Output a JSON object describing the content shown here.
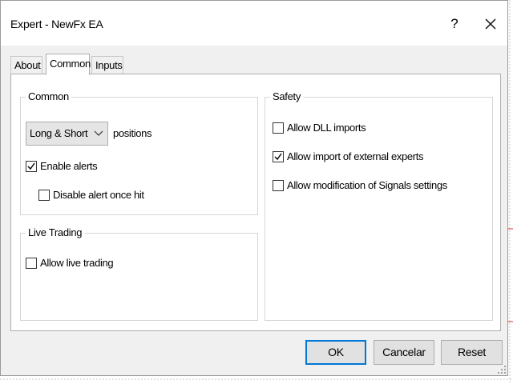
{
  "window": {
    "title": "Expert - NewFx EA",
    "help_label": "?",
    "close_label": "✕"
  },
  "tabs": [
    {
      "label": "About",
      "active": false
    },
    {
      "label": "Common",
      "active": true
    },
    {
      "label": "Inputs",
      "active": false
    }
  ],
  "common": {
    "group_label": "Common",
    "positions_select_value": "Long & Short",
    "positions_label": "positions",
    "enable_alerts": {
      "label": "Enable alerts",
      "checked": true
    },
    "disable_alert_once_hit": {
      "label": "Disable alert once hit",
      "checked": false
    }
  },
  "live_trading": {
    "group_label": "Live Trading",
    "allow_live_trading": {
      "label": "Allow live trading",
      "checked": false
    }
  },
  "safety": {
    "group_label": "Safety",
    "allow_dll_imports": {
      "label": "Allow DLL imports",
      "checked": false
    },
    "allow_import_external_experts": {
      "label": "Allow import of external experts",
      "checked": true
    },
    "allow_modification_signals": {
      "label": "Allow modification of Signals settings",
      "checked": false
    }
  },
  "buttons": {
    "ok_label": "OK",
    "cancel_label": "Cancelar",
    "reset_label": "Reset"
  },
  "colors": {
    "accent": "#0078d7",
    "dialog_bg": "#f0f0f0",
    "button_bg": "#e1e1e1"
  }
}
